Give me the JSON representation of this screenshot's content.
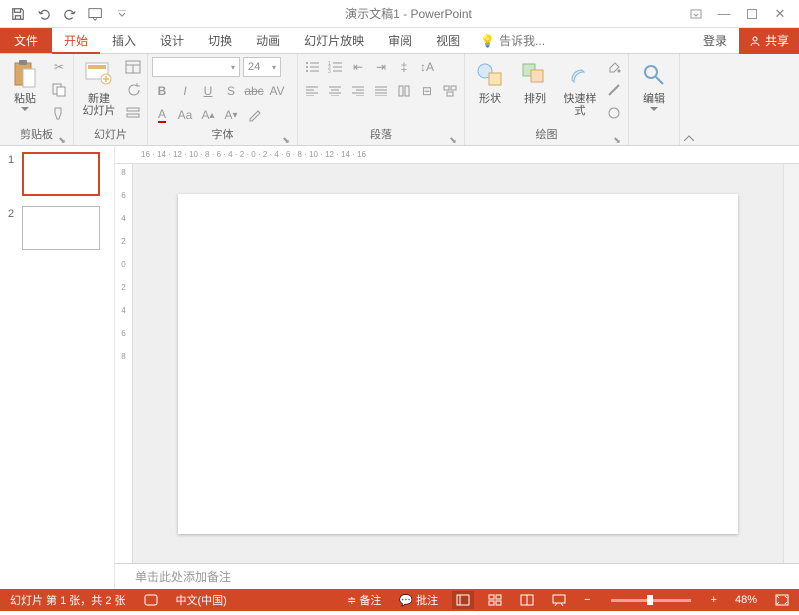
{
  "title": "演示文稿1 - PowerPoint",
  "tabs": {
    "file": "文件",
    "home": "开始",
    "insert": "插入",
    "design": "设计",
    "transitions": "切换",
    "animations": "动画",
    "slideshow": "幻灯片放映",
    "review": "审阅",
    "view": "视图",
    "tellme": "告诉我...",
    "login": "登录",
    "share": "共享"
  },
  "ribbon": {
    "clipboard": {
      "label": "剪贴板",
      "paste": "粘贴"
    },
    "slides": {
      "label": "幻灯片",
      "new_slide": "新建\n幻灯片"
    },
    "font": {
      "label": "字体",
      "size_value": "24"
    },
    "paragraph": {
      "label": "段落"
    },
    "drawing": {
      "label": "绘图",
      "shapes": "形状",
      "arrange": "排列",
      "quick_styles": "快速样式"
    },
    "editing": {
      "label": "",
      "edit": "编辑"
    }
  },
  "ruler_ticks": [
    "16",
    "14",
    "12",
    "10",
    "8",
    "6",
    "4",
    "2",
    "0",
    "2",
    "4",
    "6",
    "8",
    "10",
    "12",
    "14",
    "16"
  ],
  "vruler_ticks": [
    "8",
    "6",
    "4",
    "2",
    "0",
    "2",
    "4",
    "6",
    "8"
  ],
  "thumbnails": [
    {
      "num": "1",
      "selected": true
    },
    {
      "num": "2",
      "selected": false
    }
  ],
  "notes_placeholder": "单击此处添加备注",
  "status": {
    "slide_info": "幻灯片 第 1 张，共 2 张",
    "language": "中文(中国)",
    "notes_btn": "备注",
    "comments_btn": "批注",
    "zoom": "48%"
  }
}
